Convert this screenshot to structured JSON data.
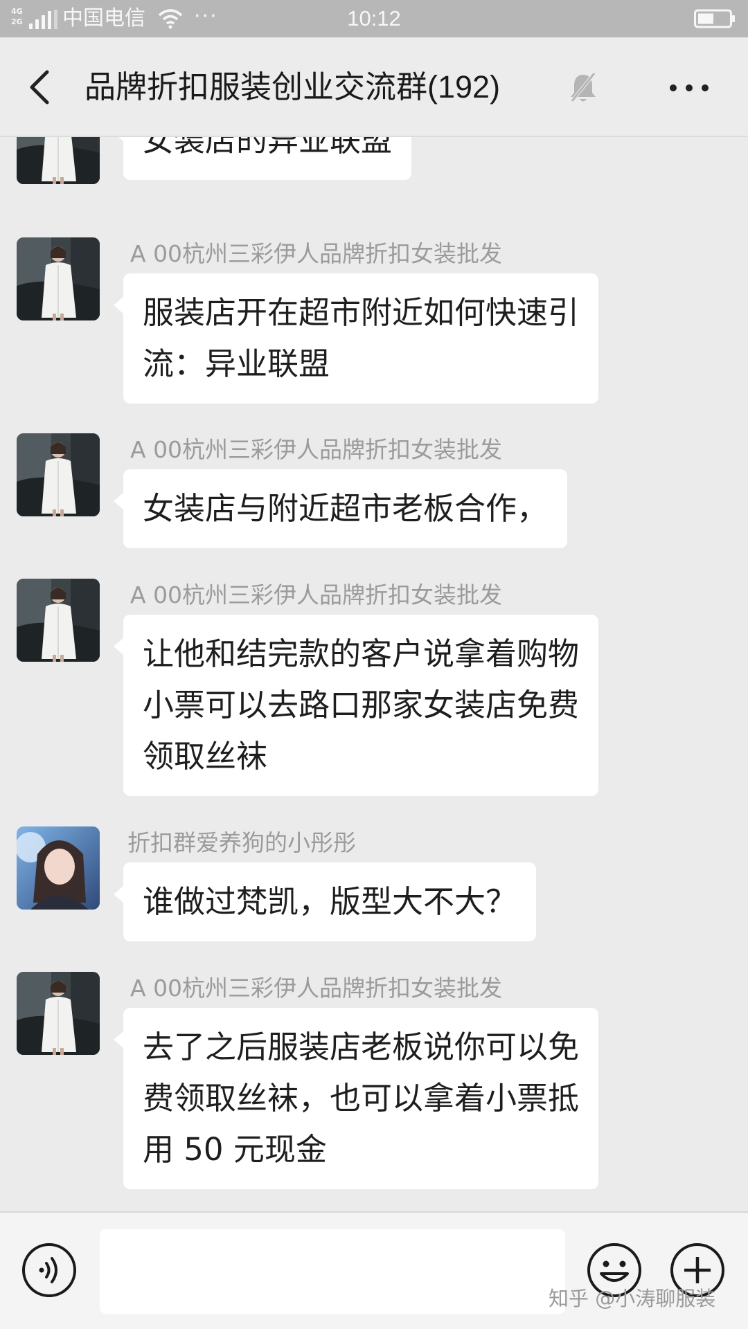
{
  "status_bar": {
    "network_top": "4G",
    "network_bottom": "2G",
    "carrier": "中国电信",
    "more": "···",
    "time": "10:12"
  },
  "header": {
    "title": "品牌折扣服装创业交流群",
    "member_count": "(192)"
  },
  "messages": [
    {
      "sender": "",
      "lines": [
        "女装店的异业联盟"
      ],
      "avatar": "portrait-white-coat"
    },
    {
      "sender": "A 00杭州三彩伊人品牌折扣女装批发",
      "lines": [
        "服装店开在超市附近如何快速引",
        "流：异业联盟"
      ],
      "avatar": "portrait-white-coat"
    },
    {
      "sender": "A 00杭州三彩伊人品牌折扣女装批发",
      "lines": [
        "女装店与附近超市老板合作，"
      ],
      "avatar": "portrait-white-coat"
    },
    {
      "sender": "A 00杭州三彩伊人品牌折扣女装批发",
      "lines": [
        "让他和结完款的客户说拿着购物",
        "小票可以去路口那家女装店免费",
        "领取丝袜"
      ],
      "avatar": "portrait-white-coat"
    },
    {
      "sender": "折扣群爱养狗的小彤彤",
      "lines": [
        "谁做过梵凯，版型大不大？"
      ],
      "avatar": "portrait-selfie"
    },
    {
      "sender": "A 00杭州三彩伊人品牌折扣女装批发",
      "lines": [
        "去了之后服装店老板说你可以免",
        "费领取丝袜，也可以拿着小票抵",
        "用 50 元现金"
      ],
      "avatar": "portrait-white-coat"
    }
  ],
  "input_bar": {
    "placeholder": "",
    "watermark": "知乎 @小涛聊服装"
  },
  "colors": {
    "chat_background": "#ebebeb",
    "bubble": "#ffffff",
    "status_bar": "#b7b7b7",
    "sender_name": "#9b9b9b"
  }
}
